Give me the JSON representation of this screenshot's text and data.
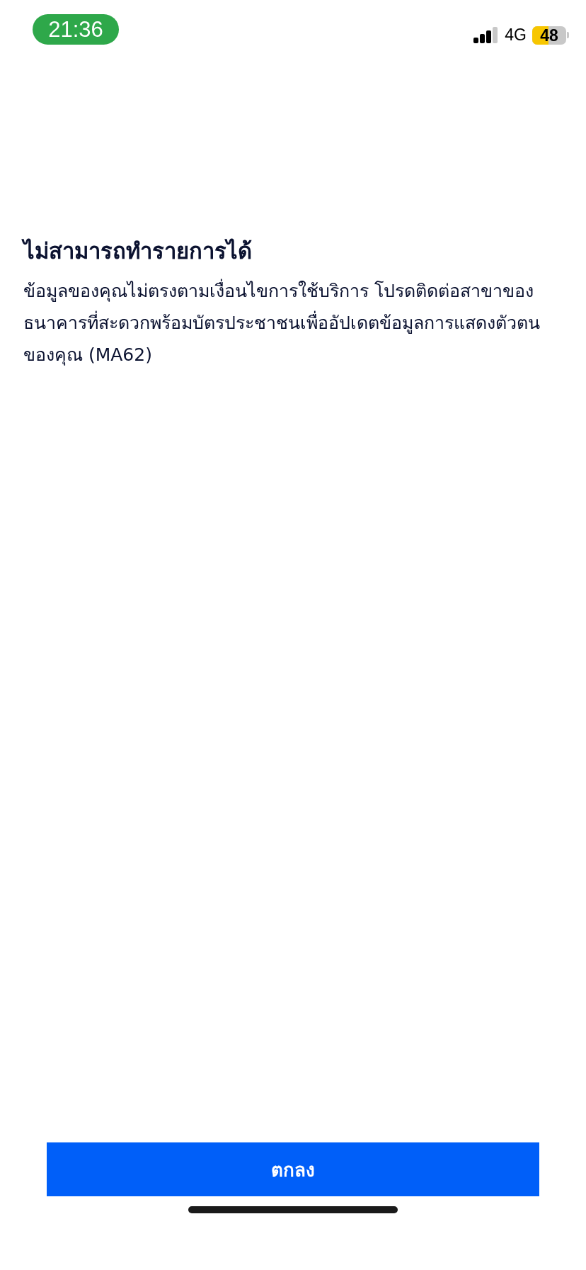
{
  "status_bar": {
    "time": "21:36",
    "network": "4G",
    "battery": "48"
  },
  "title": "ไม่สามารถทำรายการได้",
  "message": "ข้อมูลของคุณไม่ตรงตามเงื่อนไขการใช้บริการ โปรดติดต่อสาขาของธนาคารที่สะดวกพร้อมบัตรประชาชนเพื่ออัปเดตข้อมูลการแสดงตัวตนของคุณ (MA62)",
  "buttons": [
    {
      "label": "ตกลง",
      "kind": "primary"
    }
  ]
}
